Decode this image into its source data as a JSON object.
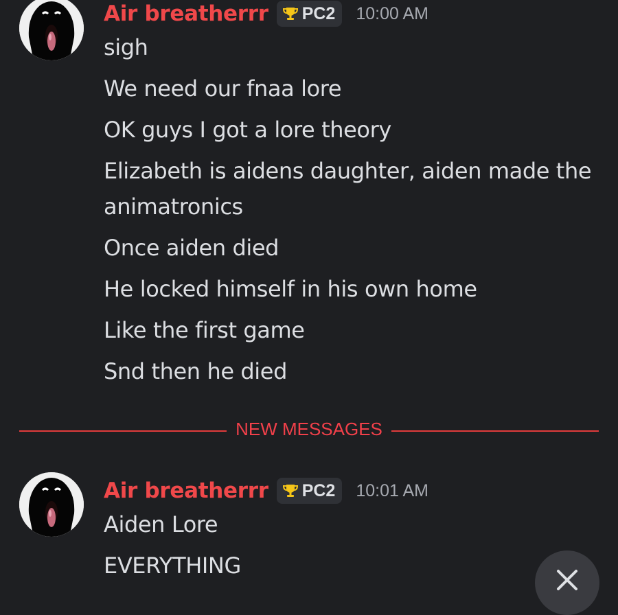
{
  "messages": [
    {
      "username": "Air breatherrr",
      "badge": "PC2",
      "timestamp": "10:00 AM",
      "lines": [
        "sigh",
        "We need our fnaa lore",
        "OK guys I got a lore theory",
        "Elizabeth is aidens daughter, aiden made the",
        "animatronics",
        "Once aiden died",
        "He locked himself in his own home",
        "Like the first game",
        "Snd then he died"
      ]
    },
    {
      "username": "Air breatherrr",
      "badge": "PC2",
      "timestamp": "10:01 AM",
      "lines": [
        "Aiden Lore",
        "EVERYTHING"
      ]
    }
  ],
  "divider": {
    "label": "NEW MESSAGES"
  },
  "icons": {
    "badge": "trophy-icon",
    "fab": "close-icon"
  },
  "colors": {
    "background": "#1e1f22",
    "username": "#f0484a",
    "new_messages": "#f2404a",
    "text": "#dcdee2",
    "timestamp": "#a6a9b0"
  }
}
